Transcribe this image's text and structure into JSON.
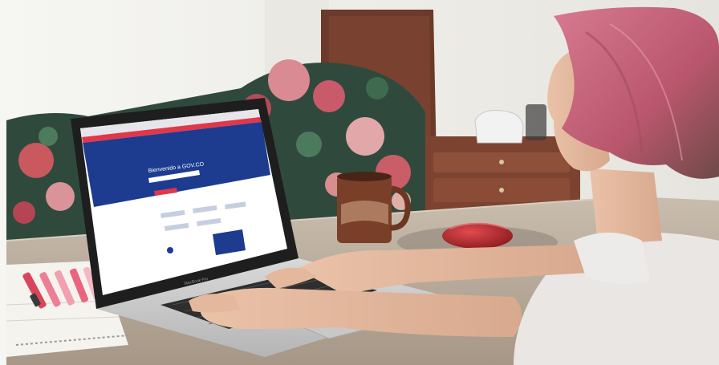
{
  "photo": {
    "screen": {
      "hero_title": "Bienvenido a GOV.CO"
    },
    "laptop": {
      "brand": "MacBook Pro"
    },
    "colors": {
      "site_blue": "#1d3b8f",
      "site_red": "#e0374a",
      "hair_pink": "#c8677d",
      "mug_brown": "#7a3f28",
      "mouse_red": "#c0282e",
      "wall": "#f0efea",
      "table": "#b9ab9a"
    }
  }
}
